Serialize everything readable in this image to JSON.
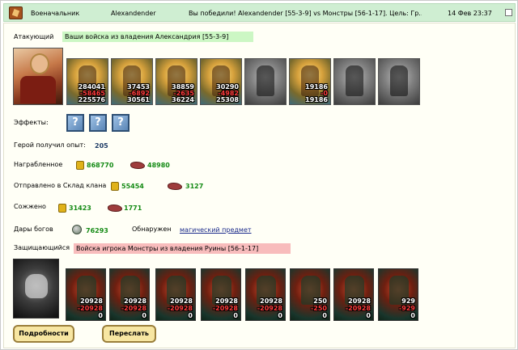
{
  "header": {
    "role": "Военачальник",
    "player": "Alexandender",
    "subject": "Вы победили! Alexandender [55-3-9] vs Монстры [56-1-17]. Цель: Гр...",
    "date": "14 Фев 23:37"
  },
  "attacker": {
    "label": "Атакующий",
    "description": "Ваши войска из владения Александрия [55-3-9]",
    "units": [
      {
        "alive": "284041",
        "lost": "-58465",
        "remaining": "225576",
        "state": "color"
      },
      {
        "alive": "37453",
        "lost": "-6892",
        "remaining": "30561",
        "state": "color"
      },
      {
        "alive": "38859",
        "lost": "-2635",
        "remaining": "36224",
        "state": "color"
      },
      {
        "alive": "30290",
        "lost": "-4982",
        "remaining": "25308",
        "state": "color"
      },
      {
        "alive": "",
        "lost": "",
        "remaining": "",
        "state": "grey"
      },
      {
        "alive": "19186",
        "lost": "-0",
        "remaining": "19186",
        "state": "color"
      },
      {
        "alive": "",
        "lost": "",
        "remaining": "",
        "state": "grey"
      },
      {
        "alive": "",
        "lost": "",
        "remaining": "",
        "state": "grey"
      }
    ]
  },
  "effects": {
    "label": "Эффекты:",
    "icons": [
      "?",
      "?",
      "?"
    ]
  },
  "experience": {
    "label": "Герой получил опыт:",
    "value": "205"
  },
  "loot": {
    "label": "Награбленное",
    "gold": "868770",
    "ore": "48980"
  },
  "clan": {
    "label": "Отправлено в Склад клана",
    "gold": "55454",
    "ore": "3127"
  },
  "burned": {
    "label": "Сожжено",
    "gold": "31423",
    "ore": "1771"
  },
  "gifts": {
    "label": "Дары богов",
    "value": "76293",
    "found_label": "Обнаружен",
    "found_link": "магический предмет"
  },
  "defender": {
    "label": "Защищающийся",
    "description": "Войска игрока Монстры из владения Руины [56-1-17]",
    "units": [
      {
        "alive": "20928",
        "lost": "-20928",
        "remaining": "0"
      },
      {
        "alive": "20928",
        "lost": "-20928",
        "remaining": "0"
      },
      {
        "alive": "20928",
        "lost": "-20928",
        "remaining": "0"
      },
      {
        "alive": "20928",
        "lost": "-20928",
        "remaining": "0"
      },
      {
        "alive": "20928",
        "lost": "-20928",
        "remaining": "0"
      },
      {
        "alive": "250",
        "lost": "-250",
        "remaining": "0"
      },
      {
        "alive": "20928",
        "lost": "-20928",
        "remaining": "0"
      },
      {
        "alive": "929",
        "lost": "-929",
        "remaining": "0"
      }
    ]
  },
  "buttons": {
    "details": "Подробности",
    "forward": "Переслать"
  },
  "colors": {
    "header_bg": "#cfeed2",
    "attacker_bar": "#ccf7c4",
    "defender_bar": "#f8bcbc",
    "value_green": "#158b15"
  }
}
